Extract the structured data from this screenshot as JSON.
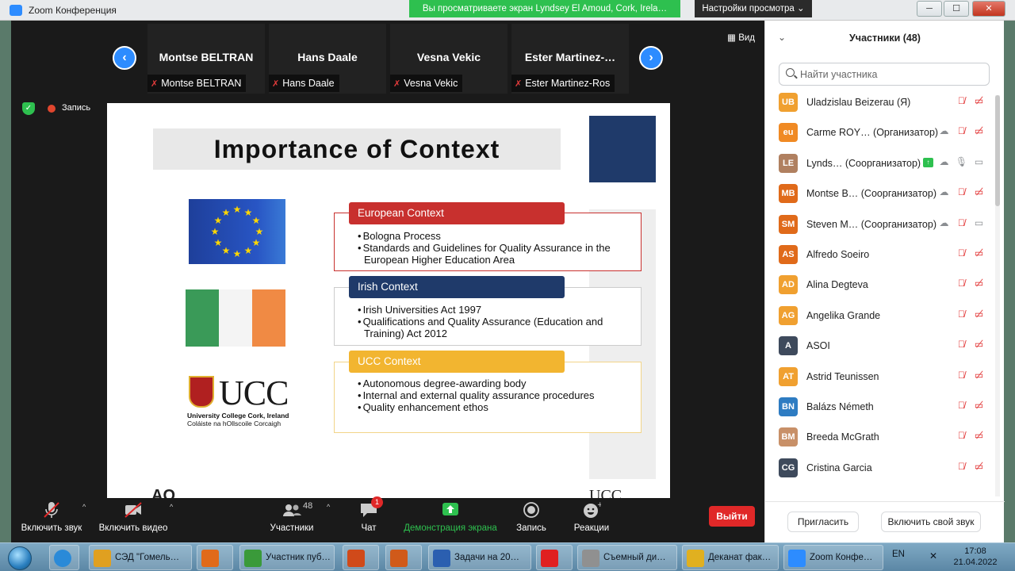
{
  "window": {
    "title": "Zoom Конференция",
    "share_banner": "Вы просматриваете экран Lyndsey El Amoud, Cork, Irela…",
    "view_settings": "Настройки просмотра",
    "minimize": "─",
    "maximize": "☐",
    "close": "✕"
  },
  "strip": {
    "prev": "‹",
    "next": "›",
    "view_label": "Вид",
    "tiles": [
      {
        "big": "Montse BELTRAN",
        "small": "Montse BELTRAN"
      },
      {
        "big": "Hans Daale",
        "small": "Hans Daale"
      },
      {
        "big": "Vesna Vekic",
        "small": "Vesna Vekic"
      },
      {
        "big": "Ester  Martinez-…",
        "small": "Ester Martinez-Ros"
      }
    ]
  },
  "status": {
    "record_label": "Запись"
  },
  "slide": {
    "title": "Importance of Context",
    "contexts": [
      {
        "header": "European Context",
        "color": "#c8302e",
        "border": "#c8302e",
        "items": [
          "Bologna Process",
          "Standards and Guidelines for Quality Assurance in the European Higher Education Area"
        ]
      },
      {
        "header": "Irish Context",
        "color": "#1f3a6a",
        "border": "#cccccc",
        "items": [
          "Irish Universities Act 1997",
          "Qualifications and Quality Assurance (Education and Training) Act 2012"
        ]
      },
      {
        "header": "UCC Context",
        "color": "#f2b530",
        "border": "#f2d488",
        "items": [
          "Autonomous degree-awarding body",
          "Internal and external quality assurance procedures",
          "Quality enhancement ethos"
        ]
      }
    ],
    "ucc_logo_text": "UCC",
    "ucc_line1": "University College Cork, Ireland",
    "ucc_line2": "Coláiste na hOllscoile Corcaigh",
    "bottom_left_stub": "AQ",
    "bottom_right_stub": "UCC"
  },
  "toolbar": {
    "unmute": "Включить звук",
    "start_video": "Включить видео",
    "participants": "Участники",
    "participants_count": "48",
    "chat": "Чат",
    "chat_badge": "1",
    "share": "Демонстрация экрана",
    "record": "Запись",
    "reactions": "Реакции",
    "leave": "Выйти",
    "caret": "^"
  },
  "panel": {
    "title": "Участники (48)",
    "collapse": "⌄",
    "search_placeholder": "Найти участника",
    "participants": [
      {
        "initials": "UB",
        "name": "Uladzislau Beizerau (Я)",
        "color": "#f0a030",
        "icons": [
          "mic-off",
          "vid-off"
        ]
      },
      {
        "initials": "eu",
        "name": "Carme ROY… (Организатор)",
        "color": "#f08a24",
        "icons": [
          "cloud",
          "mic-off",
          "vid-off"
        ]
      },
      {
        "initials": "LE",
        "name": "Lynds… (Соорганизатор)",
        "color": "#b08060",
        "icons": [
          "share",
          "cloud",
          "mic-on",
          "vid-on"
        ]
      },
      {
        "initials": "MB",
        "name": "Montse B… (Соорганизатор)",
        "color": "#e06a1a",
        "icons": [
          "cloud",
          "mic-off",
          "vid-off"
        ]
      },
      {
        "initials": "SM",
        "name": "Steven M… (Соорганизатор)",
        "color": "#e06a1a",
        "icons": [
          "cloud",
          "mic-off",
          "vid-on"
        ]
      },
      {
        "initials": "AS",
        "name": "Alfredo Soeiro",
        "color": "#e06a1a",
        "icons": [
          "mic-off",
          "vid-off"
        ]
      },
      {
        "initials": "AD",
        "name": "Alina Degteva",
        "color": "#f0a030",
        "icons": [
          "mic-off",
          "vid-off"
        ]
      },
      {
        "initials": "AG",
        "name": "Angelika Grande",
        "color": "#f0a030",
        "icons": [
          "mic-off",
          "vid-off"
        ]
      },
      {
        "initials": "A",
        "name": "ASOI",
        "color": "#3e4a5c",
        "icons": [
          "mic-off",
          "vid-off"
        ]
      },
      {
        "initials": "AT",
        "name": "Astrid Teunissen",
        "color": "#f0a030",
        "icons": [
          "mic-off",
          "vid-off"
        ]
      },
      {
        "initials": "BN",
        "name": "Balázs Németh",
        "color": "#2e7cc2",
        "icons": [
          "mic-off",
          "vid-off"
        ]
      },
      {
        "initials": "BM",
        "name": "Breeda McGrath",
        "color": "#c89068",
        "icons": [
          "mic-off",
          "vid-off"
        ]
      },
      {
        "initials": "CG",
        "name": "Cristina Garcia",
        "color": "#3e4a5c",
        "icons": [
          "mic-off",
          "vid-off"
        ]
      }
    ],
    "invite": "Пригласить",
    "unmute_self": "Включить свой звук"
  },
  "taskbar": {
    "items": [
      {
        "label": "СЭД \"Гомель…",
        "color": "#e0a020"
      },
      {
        "label": "",
        "color": "#e06a1a"
      },
      {
        "label": "Участник пуб…",
        "color": "#3a9a3a"
      },
      {
        "label": "",
        "color": "#d04a1a"
      },
      {
        "label": "",
        "color": "#d05a1a"
      },
      {
        "label": "Задачи на 20…",
        "color": "#2b5fb0"
      },
      {
        "label": "",
        "color": "#e02020"
      },
      {
        "label": "Съемный ди…",
        "color": "#909090"
      },
      {
        "label": "Деканат фак…",
        "color": "#e0b020"
      },
      {
        "label": "Zoom Конфе…",
        "color": "#2d8cff"
      }
    ],
    "lang": "EN",
    "time": "17:08",
    "date": "21.04.2022"
  },
  "icons": {
    "share_icon": "↑",
    "mic_off": "🎙",
    "vid_off": "▭"
  }
}
